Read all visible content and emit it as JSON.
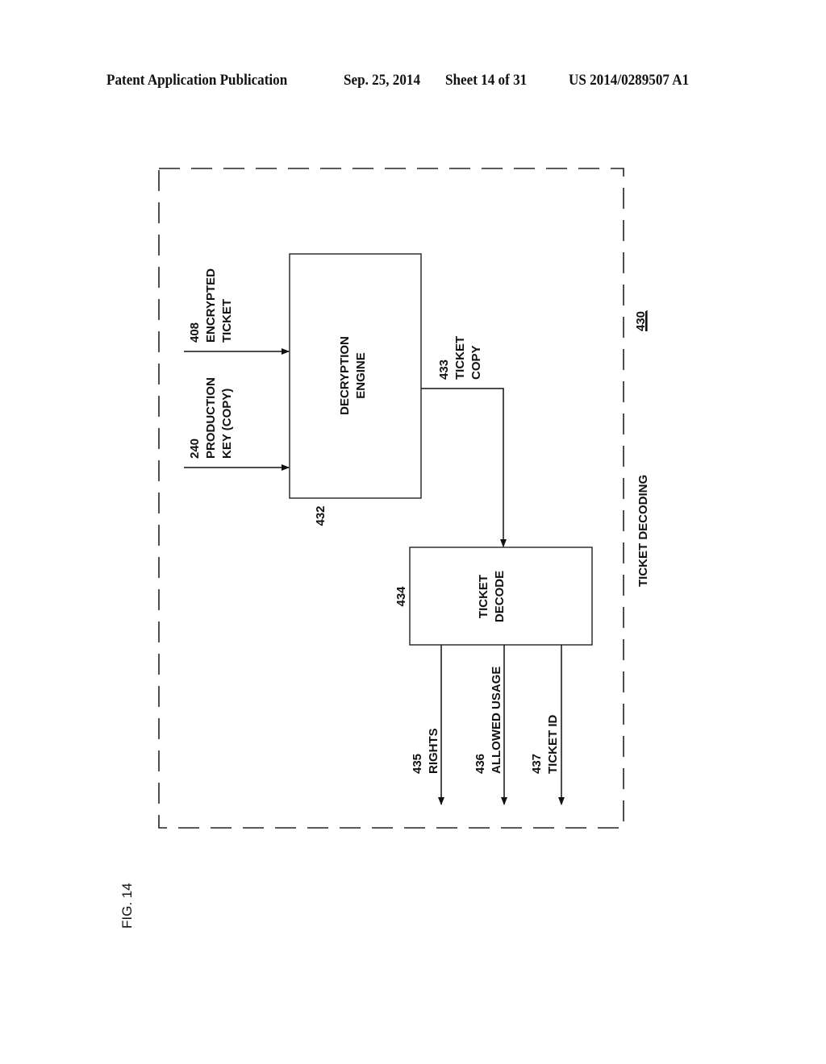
{
  "header": {
    "publication": "Patent Application Publication",
    "date": "Sep. 25, 2014",
    "sheet": "Sheet 14 of 31",
    "number": "US 2014/0289507 A1"
  },
  "figure": {
    "label": "FIG. 14",
    "container": {
      "ref": "430",
      "title": "TICKET DECODING"
    },
    "blocks": [
      {
        "ref": "432",
        "line1": "DECRYPTION",
        "line2": "ENGINE"
      },
      {
        "ref": "434",
        "line1": "TICKET",
        "line2": "DECODE"
      }
    ],
    "inputs": [
      {
        "ref": "408",
        "line1": "ENCRYPTED",
        "line2": "TICKET"
      },
      {
        "ref": "240",
        "line1": "PRODUCTION",
        "line2": "KEY (COPY)"
      }
    ],
    "intermediate": {
      "ref": "433",
      "line1": "TICKET",
      "line2": "COPY"
    },
    "outputs": [
      {
        "ref": "435",
        "label": "RIGHTS"
      },
      {
        "ref": "436",
        "label": "ALLOWED USAGE"
      },
      {
        "ref": "437",
        "label": "TICKET ID"
      }
    ]
  }
}
